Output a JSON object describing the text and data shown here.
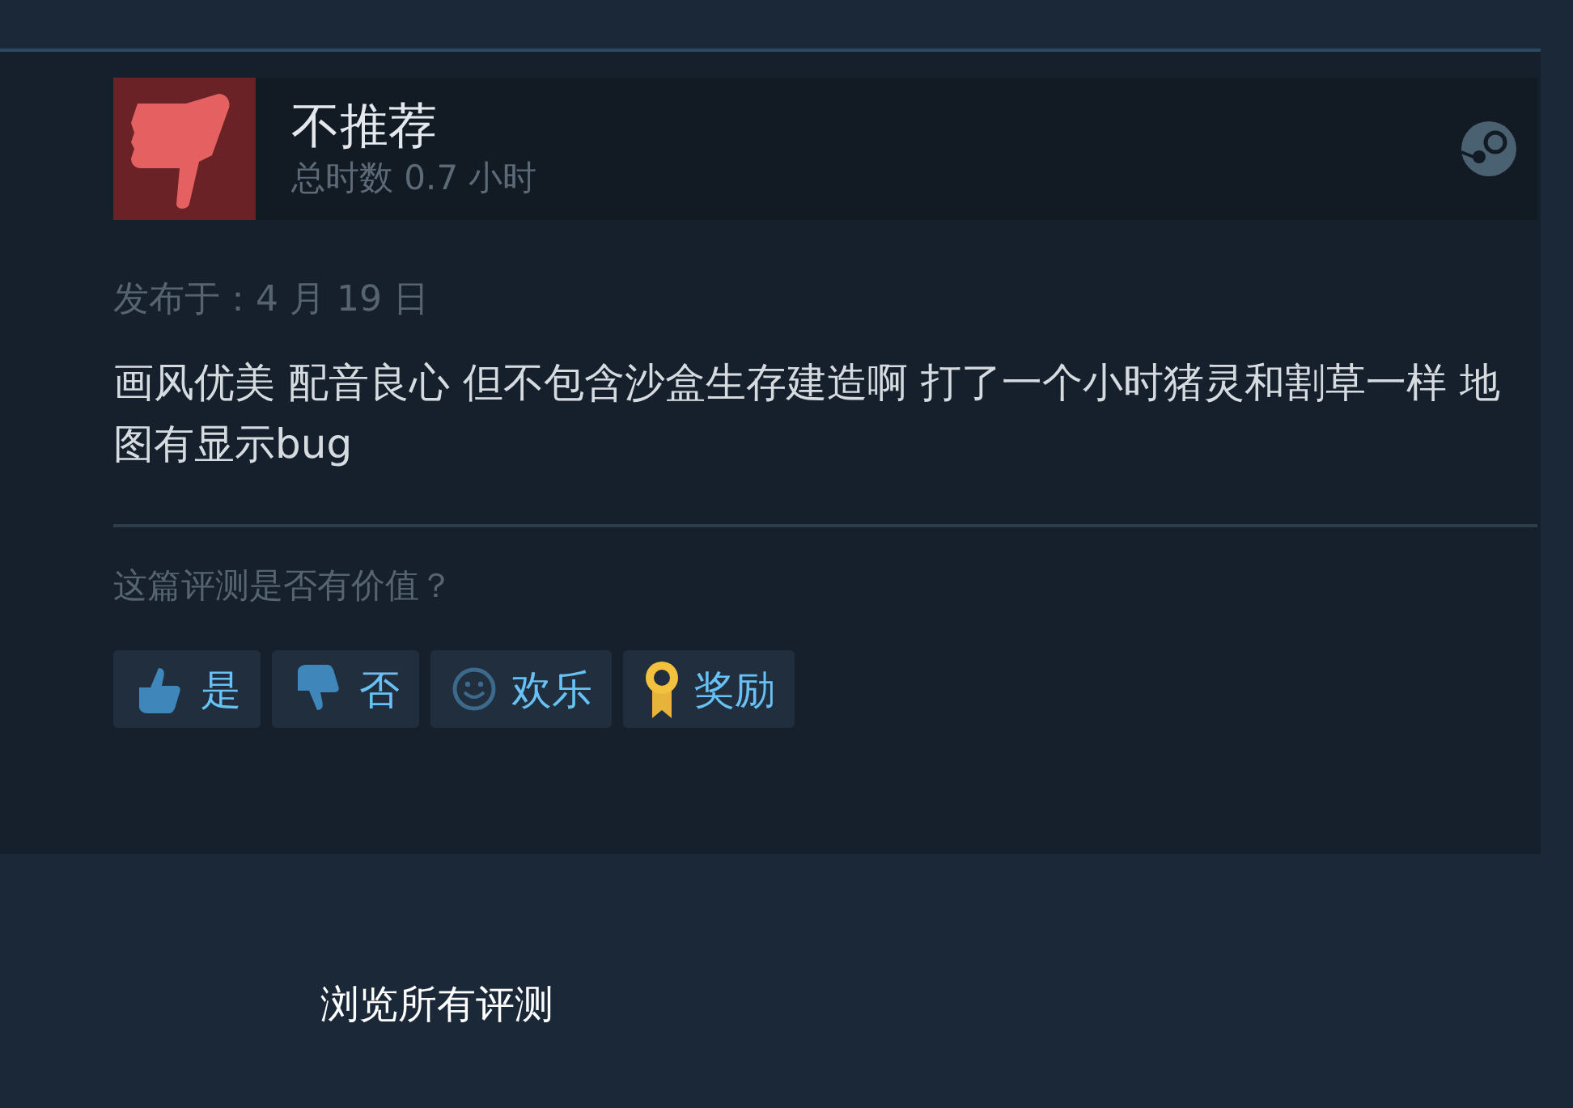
{
  "review": {
    "verdict": "不推荐",
    "recommended": false,
    "playtime": "总时数 0.7 小时",
    "posted": "发布于：4 月 19 日",
    "body": "画风优美 配音良心 但不包含沙盒生存建造啊 打了一个小时猪灵和割草一样 地图有显示bug",
    "helpful_prompt": "这篇评测是否有价值？",
    "buttons": [
      {
        "kind": "yes",
        "label": "是"
      },
      {
        "kind": "no",
        "label": "否"
      },
      {
        "kind": "funny",
        "label": "欢乐"
      },
      {
        "kind": "award",
        "label": "奖励"
      }
    ]
  },
  "footer_link": "浏览所有评测"
}
